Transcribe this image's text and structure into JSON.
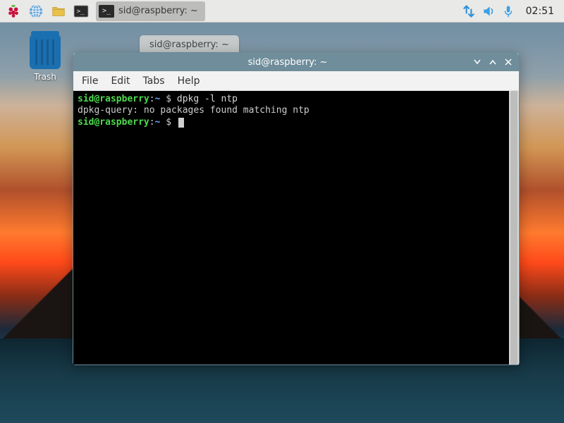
{
  "taskbar": {
    "app_title": "sid@raspberry: ~",
    "clock": "02:51"
  },
  "desktop": {
    "trash_label": "Trash"
  },
  "ghost_tab": "sid@raspberry: ~",
  "window": {
    "title": "sid@raspberry: ~",
    "menu": {
      "file": "File",
      "edit": "Edit",
      "tabs": "Tabs",
      "help": "Help"
    }
  },
  "terminal": {
    "prompt_user_host": "sid@raspberry",
    "prompt_sep": ":",
    "prompt_path": "~",
    "prompt_dollar": " $ ",
    "lines": [
      {
        "cmd": "dpkg -l ntp"
      }
    ],
    "output1": "dpkg-query: no packages found matching ntp"
  }
}
